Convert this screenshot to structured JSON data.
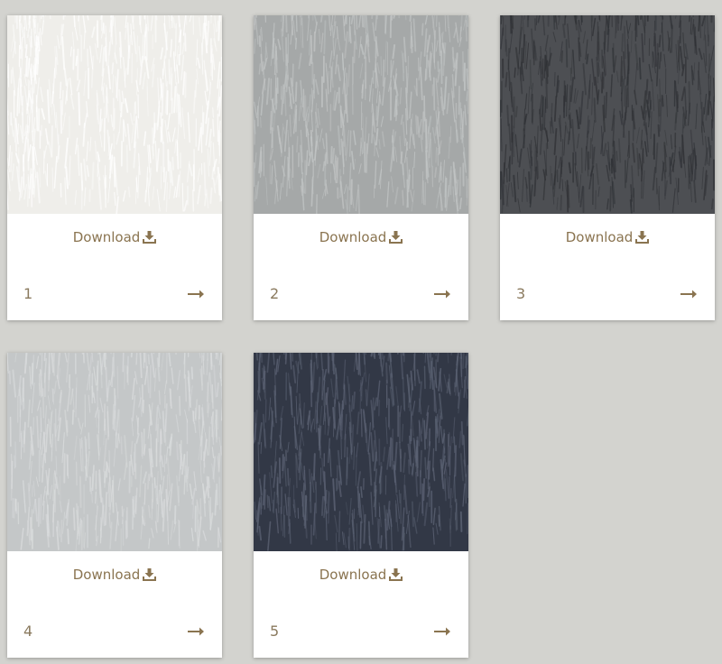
{
  "cards": [
    {
      "number": "1",
      "download_label": "Download",
      "swatch_color": "#efeeea",
      "stroke_color": "#ffffff"
    },
    {
      "number": "2",
      "download_label": "Download",
      "swatch_color": "#a5a8a8",
      "stroke_color": "#c2c5c5"
    },
    {
      "number": "3",
      "download_label": "Download",
      "swatch_color": "#4d4f53",
      "stroke_color": "#2f3135"
    },
    {
      "number": "4",
      "download_label": "Download",
      "swatch_color": "#c4c7c8",
      "stroke_color": "#dadcdd"
    },
    {
      "number": "5",
      "download_label": "Download",
      "swatch_color": "#323846",
      "stroke_color": "#5c6374"
    }
  ],
  "accent_color": "#8a7450",
  "icons": {
    "download": "download-icon",
    "arrow": "arrow-right-icon"
  }
}
